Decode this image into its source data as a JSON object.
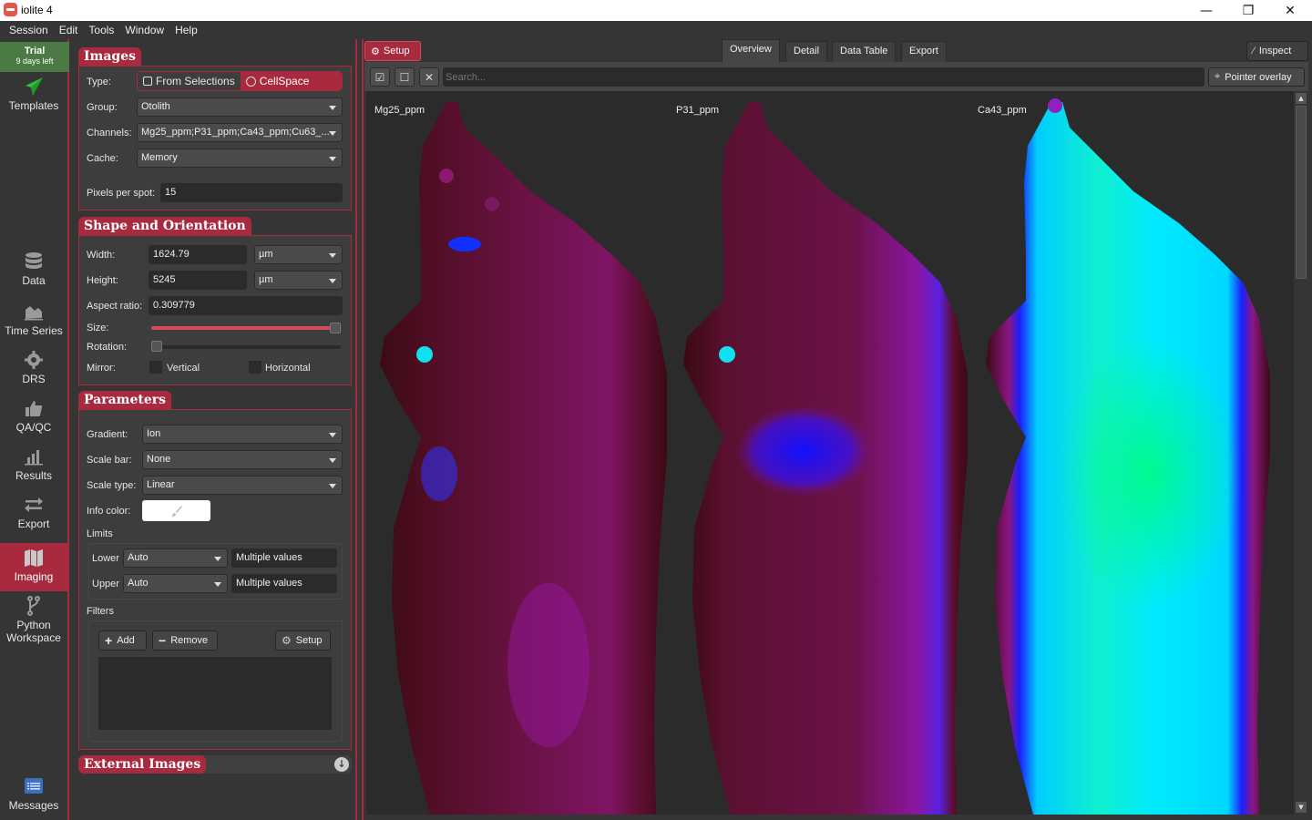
{
  "window": {
    "title": "iolite 4",
    "controls": {
      "minimize": "—",
      "restore": "❐",
      "close": "✕"
    }
  },
  "menu": [
    "Session",
    "Edit",
    "Tools",
    "Window",
    "Help"
  ],
  "trial": {
    "title": "Trial",
    "subtitle": "9 days left"
  },
  "nav": {
    "templates": "Templates",
    "data": "Data",
    "time_series": "Time Series",
    "drs": "DRS",
    "qaqc": "QA/QC",
    "results": "Results",
    "export": "Export",
    "imaging": "Imaging",
    "python": "Python Workspace",
    "messages": "Messages",
    "active": "Imaging"
  },
  "images": {
    "title": "Images",
    "type_label": "Type:",
    "type_options": [
      "From Selections",
      "CellSpace"
    ],
    "type_selected": "CellSpace",
    "group_label": "Group:",
    "group_value": "Otolith",
    "channels_label": "Channels:",
    "channels_value": "Mg25_ppm;P31_ppm;Ca43_ppm;Cu63_...",
    "cache_label": "Cache:",
    "cache_value": "Memory",
    "pps_label": "Pixels per spot:",
    "pps_value": "15"
  },
  "shape": {
    "title": "Shape and Orientation",
    "width_label": "Width:",
    "width_value": "1624.79",
    "width_unit": "µm",
    "height_label": "Height:",
    "height_value": "5245",
    "height_unit": "µm",
    "aspect_label": "Aspect ratio:",
    "aspect_value": "0.309779",
    "size_label": "Size:",
    "size_fraction": 1.0,
    "rotation_label": "Rotation:",
    "rotation_fraction": 0.0,
    "mirror_label": "Mirror:",
    "mirror_vertical": "Vertical",
    "mirror_horizontal": "Horizontal"
  },
  "params": {
    "title": "Parameters",
    "gradient_label": "Gradient:",
    "gradient_value": "Ion",
    "scalebar_label": "Scale bar:",
    "scalebar_value": "None",
    "scaletype_label": "Scale type:",
    "scaletype_value": "Linear",
    "infocolor_label": "Info color:",
    "limits_label": "Limits",
    "lower_label": "Lower",
    "lower_mode": "Auto",
    "lower_value": "Multiple values",
    "upper_label": "Upper",
    "upper_mode": "Auto",
    "upper_value": "Multiple values",
    "filters_label": "Filters",
    "add_label": "Add",
    "remove_label": "Remove",
    "setup_label": "Setup"
  },
  "external": {
    "title": "External Images"
  },
  "main": {
    "setup_tab": "Setup",
    "tabs": [
      "Overview",
      "Detail",
      "Data Table",
      "Export"
    ],
    "active_tab": "Overview",
    "inspect_label": "Inspect",
    "search_placeholder": "Search...",
    "pointer_overlay_label": "Pointer overlay",
    "channels": [
      "Mg25_ppm",
      "P31_ppm",
      "Ca43_ppm"
    ]
  }
}
